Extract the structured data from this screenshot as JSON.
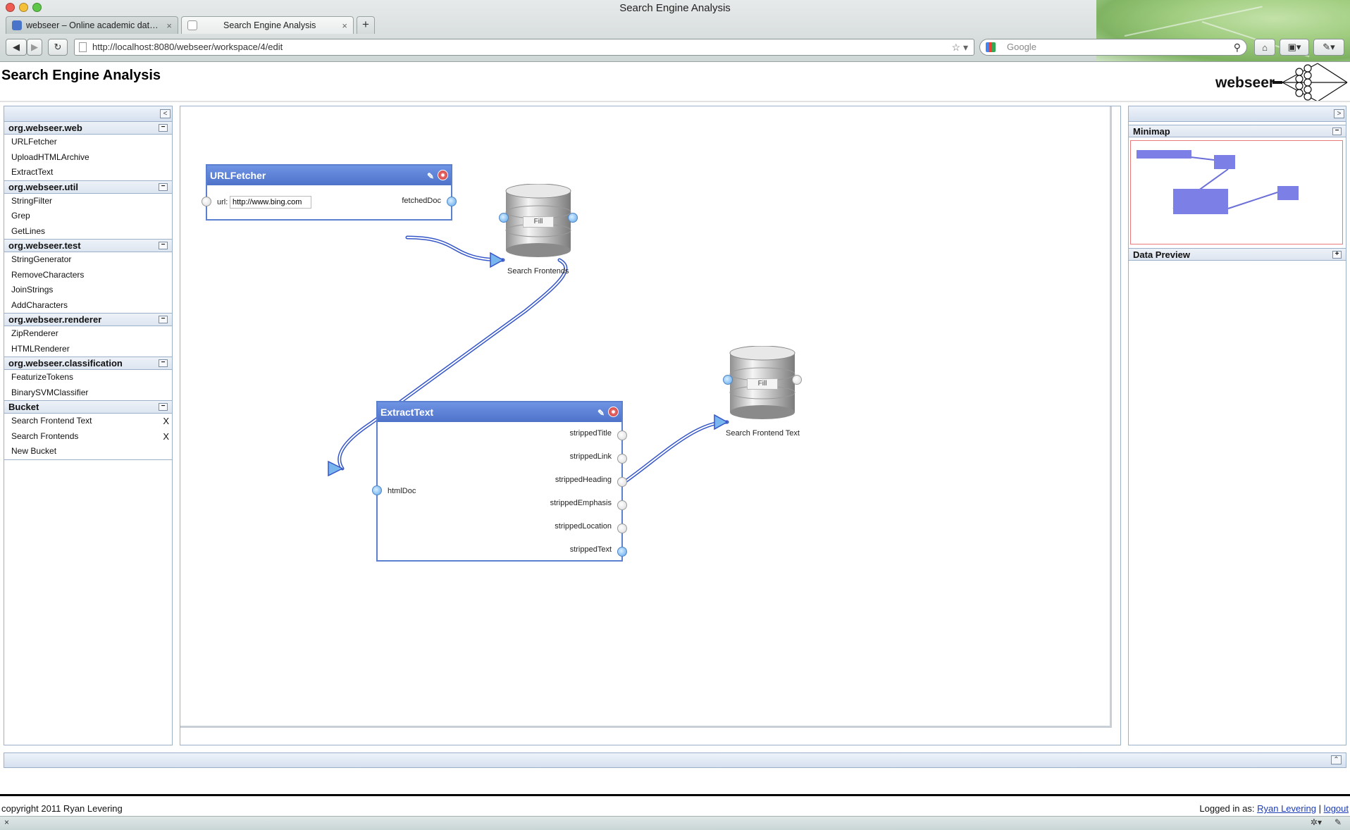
{
  "window": {
    "title": "Search Engine Analysis"
  },
  "tabs": [
    {
      "label": "webseer – Online academic dat…",
      "close": "×"
    },
    {
      "label": "Search Engine Analysis",
      "close": "×"
    }
  ],
  "new_tab": "+",
  "nav": {
    "url": "http://localhost:8080/webseer/workspace/4/edit",
    "search_placeholder": "Google"
  },
  "page": {
    "title": "Search Engine Analysis",
    "logo_text": "webseer"
  },
  "palette": {
    "groups": [
      {
        "name": "org.webseer.web",
        "items": [
          "URLFetcher",
          "UploadHTMLArchive",
          "ExtractText"
        ]
      },
      {
        "name": "org.webseer.util",
        "items": [
          "StringFilter",
          "Grep",
          "GetLines"
        ]
      },
      {
        "name": "org.webseer.test",
        "items": [
          "StringGenerator",
          "RemoveCharacters",
          "JoinStrings",
          "AddCharacters"
        ]
      },
      {
        "name": "org.webseer.renderer",
        "items": [
          "ZipRenderer",
          "HTMLRenderer"
        ]
      },
      {
        "name": "org.webseer.classification",
        "items": [
          "FeaturizeTokens",
          "BinarySVMClassifier"
        ]
      }
    ],
    "bucket": {
      "name": "Bucket",
      "items": [
        {
          "label": "Search Frontend Text",
          "delete": "X"
        },
        {
          "label": "Search Frontends",
          "delete": "X"
        },
        {
          "label": "New Bucket",
          "delete": ""
        }
      ]
    }
  },
  "workflow": {
    "url_fetcher": {
      "title": "URLFetcher",
      "input_label": "url:",
      "input_value": "http://www.bing.com",
      "output": "fetchedDoc"
    },
    "extract_text": {
      "title": "ExtractText",
      "input": "htmlDoc",
      "outputs": [
        "strippedTitle",
        "strippedLink",
        "strippedHeading",
        "strippedEmphasis",
        "strippedLocation",
        "strippedText"
      ]
    },
    "buckets": [
      {
        "label": "Search Frontends",
        "fill": "Fill"
      },
      {
        "label": "Search Frontend Text",
        "fill": "Fill"
      }
    ]
  },
  "right_panel": {
    "minimap": "Minimap",
    "data_preview": "Data Preview"
  },
  "footer": {
    "copyright": "copyright 2011 Ryan Levering",
    "logged_in_as": "Logged in as:",
    "user": "Ryan Levering",
    "sep": "|",
    "logout": "logout"
  },
  "status": {
    "left": "×"
  },
  "colors": {
    "accent": "#5b80cf",
    "panel_border": "#9cb0c9",
    "wire": "#3556c8",
    "minimap_block": "#7b7fe6"
  }
}
